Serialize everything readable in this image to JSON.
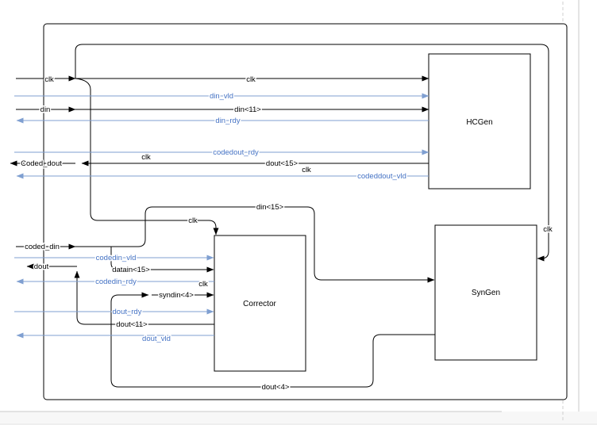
{
  "page": {
    "blocks": {
      "hcgen": "HCGen",
      "corrector": "Corrector",
      "syngen": "SynGen"
    },
    "ports": {
      "clk": "clk",
      "din": "din",
      "coded_dout": "Coded_dout",
      "coded_din": "coded_din",
      "dout": "dout"
    },
    "signals": {
      "clk": "clk",
      "din_vld": "din_vld",
      "din11": "din<11>",
      "din_rdy": "din_rdy",
      "codedout_rdy": "codedout_rdy",
      "dout15": "dout<15>",
      "codeddout_vld": "codeddout_vld",
      "din15": "din<15>",
      "codedin_vld": "codedin_vld",
      "datain15": "datain<15>",
      "codedin_rdy": "codedin_rdy",
      "syndin4": "syndin<4>",
      "dout_rdy": "dout_rdy",
      "dout11": "dout<11>",
      "dout_vld": "dout_vld",
      "dout4": "dout<4>"
    },
    "colors": {
      "wire_black": "#000000",
      "wire_blue": "#7f9fd1",
      "label_blue": "#4472c4"
    }
  }
}
